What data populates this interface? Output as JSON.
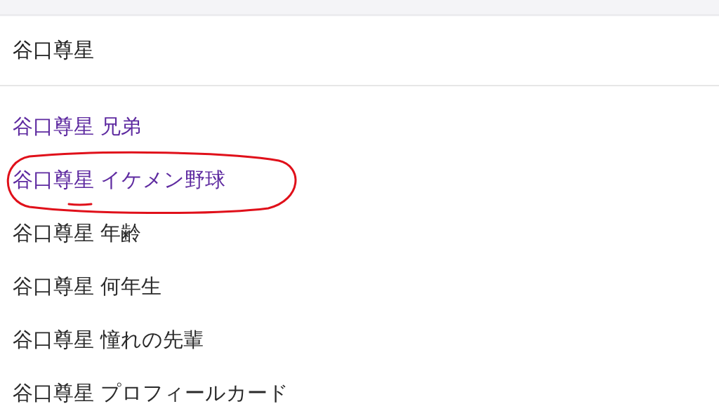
{
  "search": {
    "value": "谷口尊星"
  },
  "suggestions": [
    {
      "text": "谷口尊星 兄弟",
      "visited": true,
      "circled": false
    },
    {
      "text": "谷口尊星 イケメン野球",
      "visited": true,
      "circled": true
    },
    {
      "text": "谷口尊星 年齢",
      "visited": false,
      "circled": false
    },
    {
      "text": "谷口尊星 何年生",
      "visited": false,
      "circled": false
    },
    {
      "text": "谷口尊星 憧れの先輩",
      "visited": false,
      "circled": false
    },
    {
      "text": "谷口尊星 プロフィールカード",
      "visited": false,
      "circled": false
    }
  ]
}
